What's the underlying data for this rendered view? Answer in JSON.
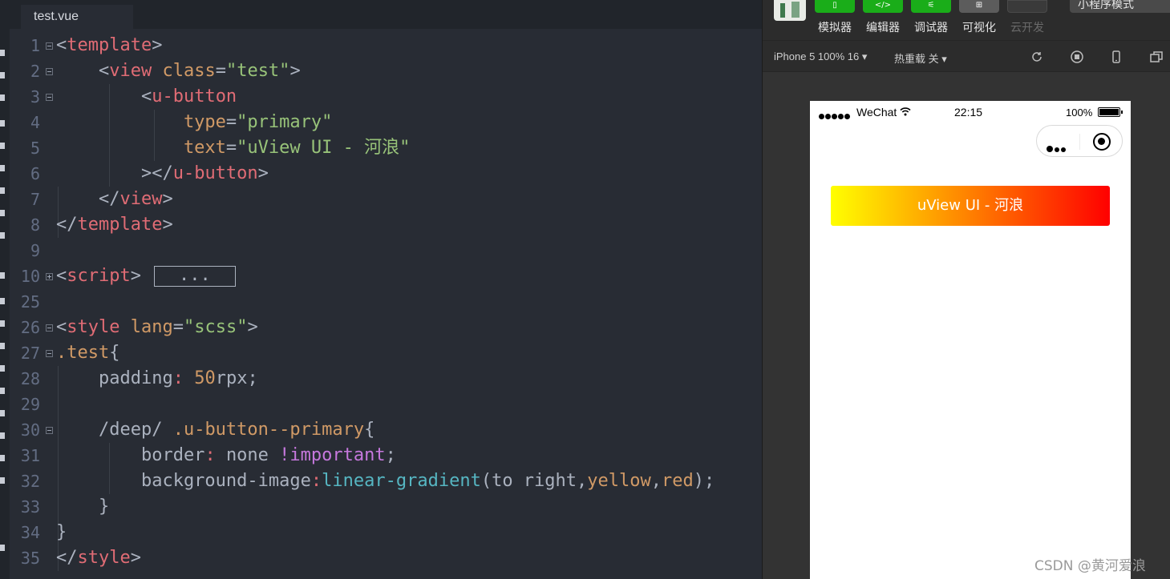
{
  "editor": {
    "tab_title": "test.vue",
    "lines": [
      {
        "n": "1",
        "fold": "minus",
        "tokens": [
          {
            "t": "<",
            "c": "t-pun"
          },
          {
            "t": "template",
            "c": "t-tag"
          },
          {
            "t": ">",
            "c": "t-pun"
          }
        ]
      },
      {
        "n": "2",
        "fold": "minus",
        "tokens": [
          {
            "t": "    <",
            "c": "t-pun"
          },
          {
            "t": "view",
            "c": "t-tag"
          },
          {
            "t": " class",
            "c": "t-attr"
          },
          {
            "t": "=",
            "c": "t-pun"
          },
          {
            "t": "\"test\"",
            "c": "t-str"
          },
          {
            "t": ">",
            "c": "t-pun"
          }
        ]
      },
      {
        "n": "3",
        "fold": "minus",
        "tokens": [
          {
            "t": "        <",
            "c": "t-pun"
          },
          {
            "t": "u-button",
            "c": "t-tag"
          }
        ]
      },
      {
        "n": "4",
        "fold": "",
        "tokens": [
          {
            "t": "            type",
            "c": "t-attr"
          },
          {
            "t": "=",
            "c": "t-pun"
          },
          {
            "t": "\"primary\"",
            "c": "t-str"
          }
        ]
      },
      {
        "n": "5",
        "fold": "",
        "tokens": [
          {
            "t": "            text",
            "c": "t-attr"
          },
          {
            "t": "=",
            "c": "t-pun"
          },
          {
            "t": "\"uView UI - 河浪\"",
            "c": "t-str"
          }
        ]
      },
      {
        "n": "6",
        "fold": "",
        "tokens": [
          {
            "t": "        ></",
            "c": "t-pun"
          },
          {
            "t": "u-button",
            "c": "t-tag"
          },
          {
            "t": ">",
            "c": "t-pun"
          }
        ]
      },
      {
        "n": "7",
        "fold": "",
        "tokens": [
          {
            "t": "    </",
            "c": "t-pun"
          },
          {
            "t": "view",
            "c": "t-tag"
          },
          {
            "t": ">",
            "c": "t-pun"
          }
        ]
      },
      {
        "n": "8",
        "fold": "",
        "tokens": [
          {
            "t": "</",
            "c": "t-pun"
          },
          {
            "t": "template",
            "c": "t-tag"
          },
          {
            "t": ">",
            "c": "t-pun"
          }
        ]
      },
      {
        "n": "9",
        "fold": "",
        "tokens": []
      },
      {
        "n": "10",
        "fold": "plus",
        "collapsed": "...",
        "tokens": [
          {
            "t": "<",
            "c": "t-pun"
          },
          {
            "t": "script",
            "c": "t-tag"
          },
          {
            "t": ">",
            "c": "t-pun"
          }
        ]
      },
      {
        "n": "25",
        "fold": "",
        "tokens": []
      },
      {
        "n": "26",
        "fold": "minus",
        "tokens": [
          {
            "t": "<",
            "c": "t-pun"
          },
          {
            "t": "style",
            "c": "t-tag"
          },
          {
            "t": " lang",
            "c": "t-attr"
          },
          {
            "t": "=",
            "c": "t-pun"
          },
          {
            "t": "\"scss\"",
            "c": "t-str"
          },
          {
            "t": ">",
            "c": "t-pun"
          }
        ]
      },
      {
        "n": "27",
        "fold": "minus",
        "tokens": [
          {
            "t": ".test",
            "c": "t-attr"
          },
          {
            "t": "{",
            "c": "t-pun"
          }
        ]
      },
      {
        "n": "28",
        "fold": "",
        "tokens": [
          {
            "t": "    padding",
            "c": "t-pun"
          },
          {
            "t": ": ",
            "c": "t-tag"
          },
          {
            "t": "50",
            "c": "t-num"
          },
          {
            "t": "rpx;",
            "c": "t-pun"
          }
        ]
      },
      {
        "n": "29",
        "fold": "",
        "tokens": []
      },
      {
        "n": "30",
        "fold": "minus",
        "tokens": [
          {
            "t": "    /deep/ ",
            "c": "t-pun"
          },
          {
            "t": ".u-button--primary",
            "c": "t-attr"
          },
          {
            "t": "{",
            "c": "t-pun"
          }
        ]
      },
      {
        "n": "31",
        "fold": "",
        "tokens": [
          {
            "t": "        border",
            "c": "t-pun"
          },
          {
            "t": ": ",
            "c": "t-tag"
          },
          {
            "t": "none ",
            "c": "t-pun"
          },
          {
            "t": "!important",
            "c": "t-kw"
          },
          {
            "t": ";",
            "c": "t-pun"
          }
        ]
      },
      {
        "n": "32",
        "fold": "",
        "tokens": [
          {
            "t": "        background-image",
            "c": "t-pun"
          },
          {
            "t": ":",
            "c": "t-tag"
          },
          {
            "t": "linear-gradient",
            "c": "t-fn"
          },
          {
            "t": "(to right,",
            "c": "t-pun"
          },
          {
            "t": "yellow",
            "c": "t-num"
          },
          {
            "t": ",",
            "c": "t-pun"
          },
          {
            "t": "red",
            "c": "t-num"
          },
          {
            "t": ");",
            "c": "t-pun"
          }
        ]
      },
      {
        "n": "33",
        "fold": "",
        "tokens": [
          {
            "t": "    }",
            "c": "t-pun"
          }
        ]
      },
      {
        "n": "34",
        "fold": "",
        "tokens": [
          {
            "t": "}",
            "c": "t-pun"
          }
        ]
      },
      {
        "n": "35",
        "fold": "",
        "tokens": [
          {
            "t": "</",
            "c": "t-pun"
          },
          {
            "t": "style",
            "c": "t-tag"
          },
          {
            "t": ">",
            "c": "t-pun"
          }
        ]
      }
    ]
  },
  "toolbar": {
    "simulator": "模拟器",
    "editor": "编辑器",
    "debugger": "调试器",
    "visualize": "可视化",
    "cloud": "云开发",
    "mode": "小程序模式"
  },
  "sim_bar": {
    "device": "iPhone 5 100% 16 ▾",
    "hot_reload": "热重载 关 ▾"
  },
  "phone": {
    "carrier": "WeChat",
    "time": "22:15",
    "battery": "100%",
    "button_text": "uView UI - 河浪"
  },
  "colors": {
    "gradient_from": "yellow",
    "gradient_to": "red",
    "accent_green": "#1aad19"
  },
  "watermark": "CSDN @黄河爱浪"
}
